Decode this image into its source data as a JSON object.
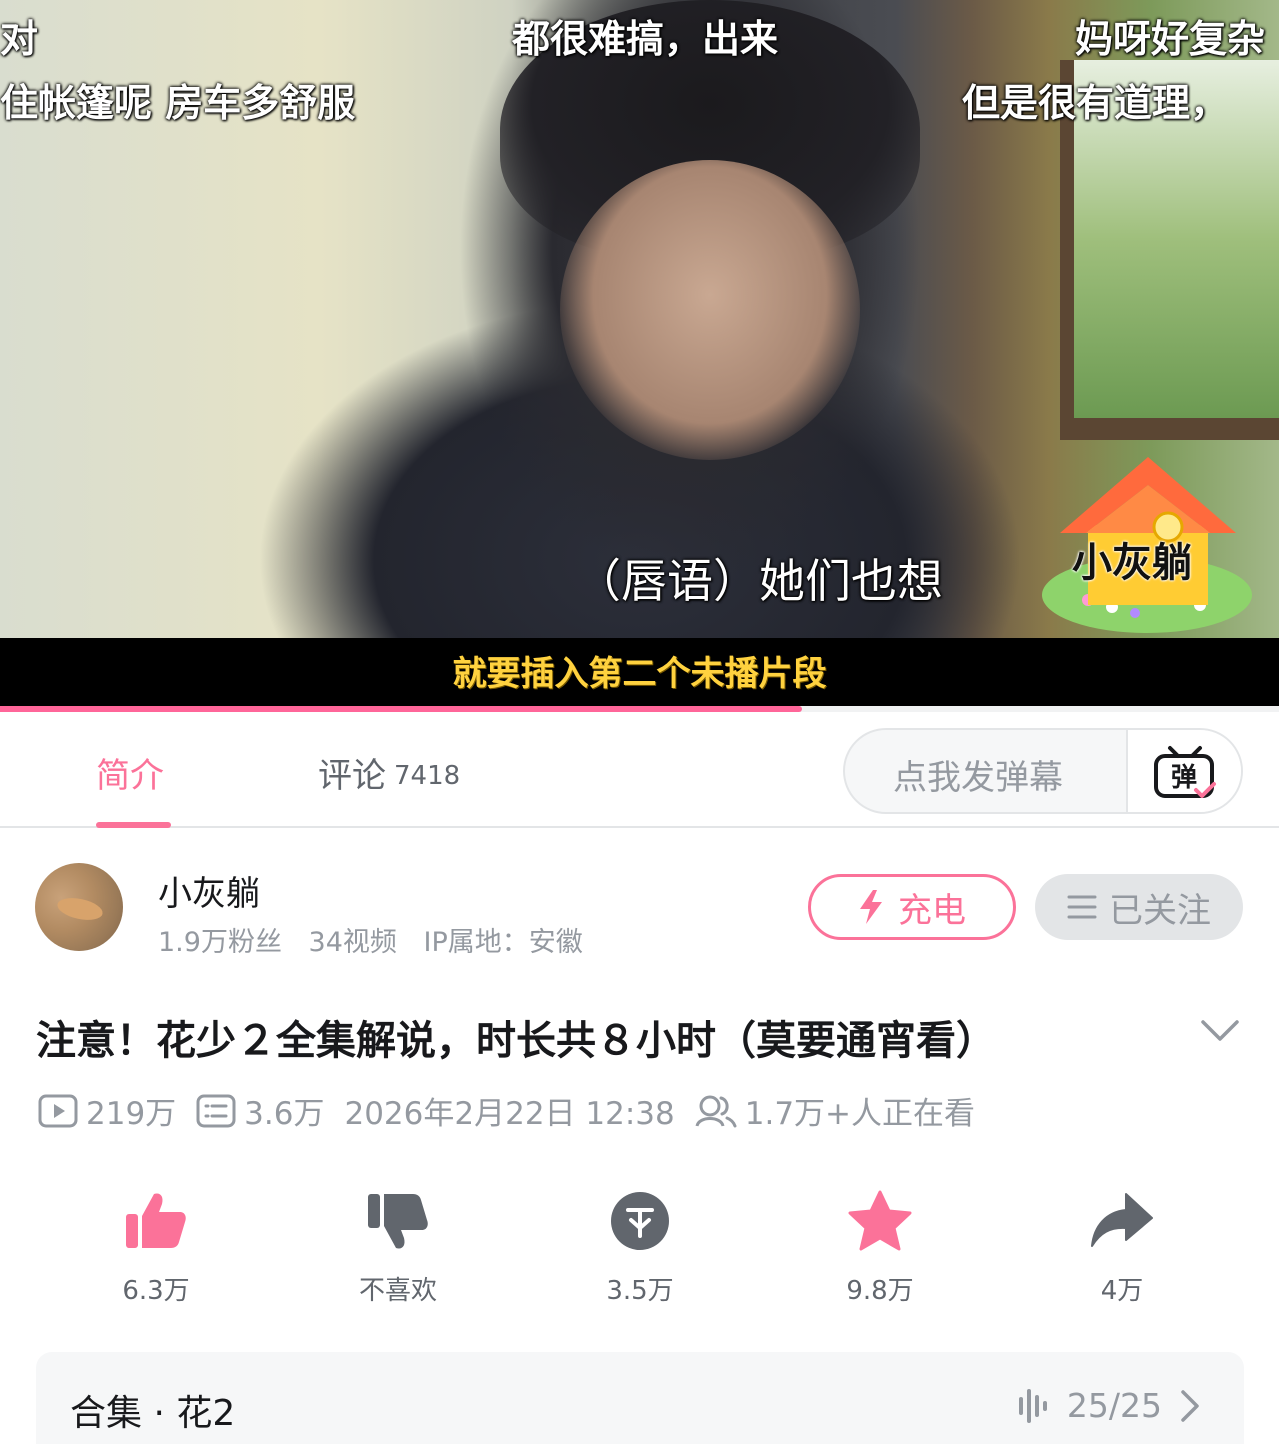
{
  "player": {
    "danmaku": [
      "对",
      "都很难搞，出来",
      "妈呀好复杂",
      "住帐篷呢 房车多舒服",
      "但是很有道理，"
    ],
    "caption_lip": "（唇语）她们也想",
    "caption_bottom": "就要插入第二个未播片段",
    "watermark": "小灰躺",
    "progress_fraction": 0.627
  },
  "tabs": {
    "intro_label": "简介",
    "comments_label": "评论",
    "comments_count": "7418",
    "danmu_placeholder": "点我发弹幕",
    "danmu_button_icon": "danmaku-toggle-icon"
  },
  "uploader": {
    "name": "小灰躺",
    "followers": "1.9万粉丝",
    "videos": "34视频",
    "ip": "IP属地：安徽",
    "charge_label": "充电",
    "follow_label": "已关注"
  },
  "video": {
    "title": "注意！花少２全集解说，时长共８小时（莫要通宵看）",
    "views": "219万",
    "danmaku_count": "3.6万",
    "date": "2026年2月22日 12:38",
    "watching": "1.7万+人正在看"
  },
  "actions": {
    "like": "6.3万",
    "dislike": "不喜欢",
    "coin": "3.5万",
    "favorite": "9.8万",
    "share": "4万"
  },
  "collection": {
    "title": "合集 · 花2",
    "progress": "25/25"
  },
  "colors": {
    "accent": "#fb7299",
    "progress": "#ff6699",
    "caption_yellow": "#ffd23f",
    "muted": "#9499a0"
  }
}
